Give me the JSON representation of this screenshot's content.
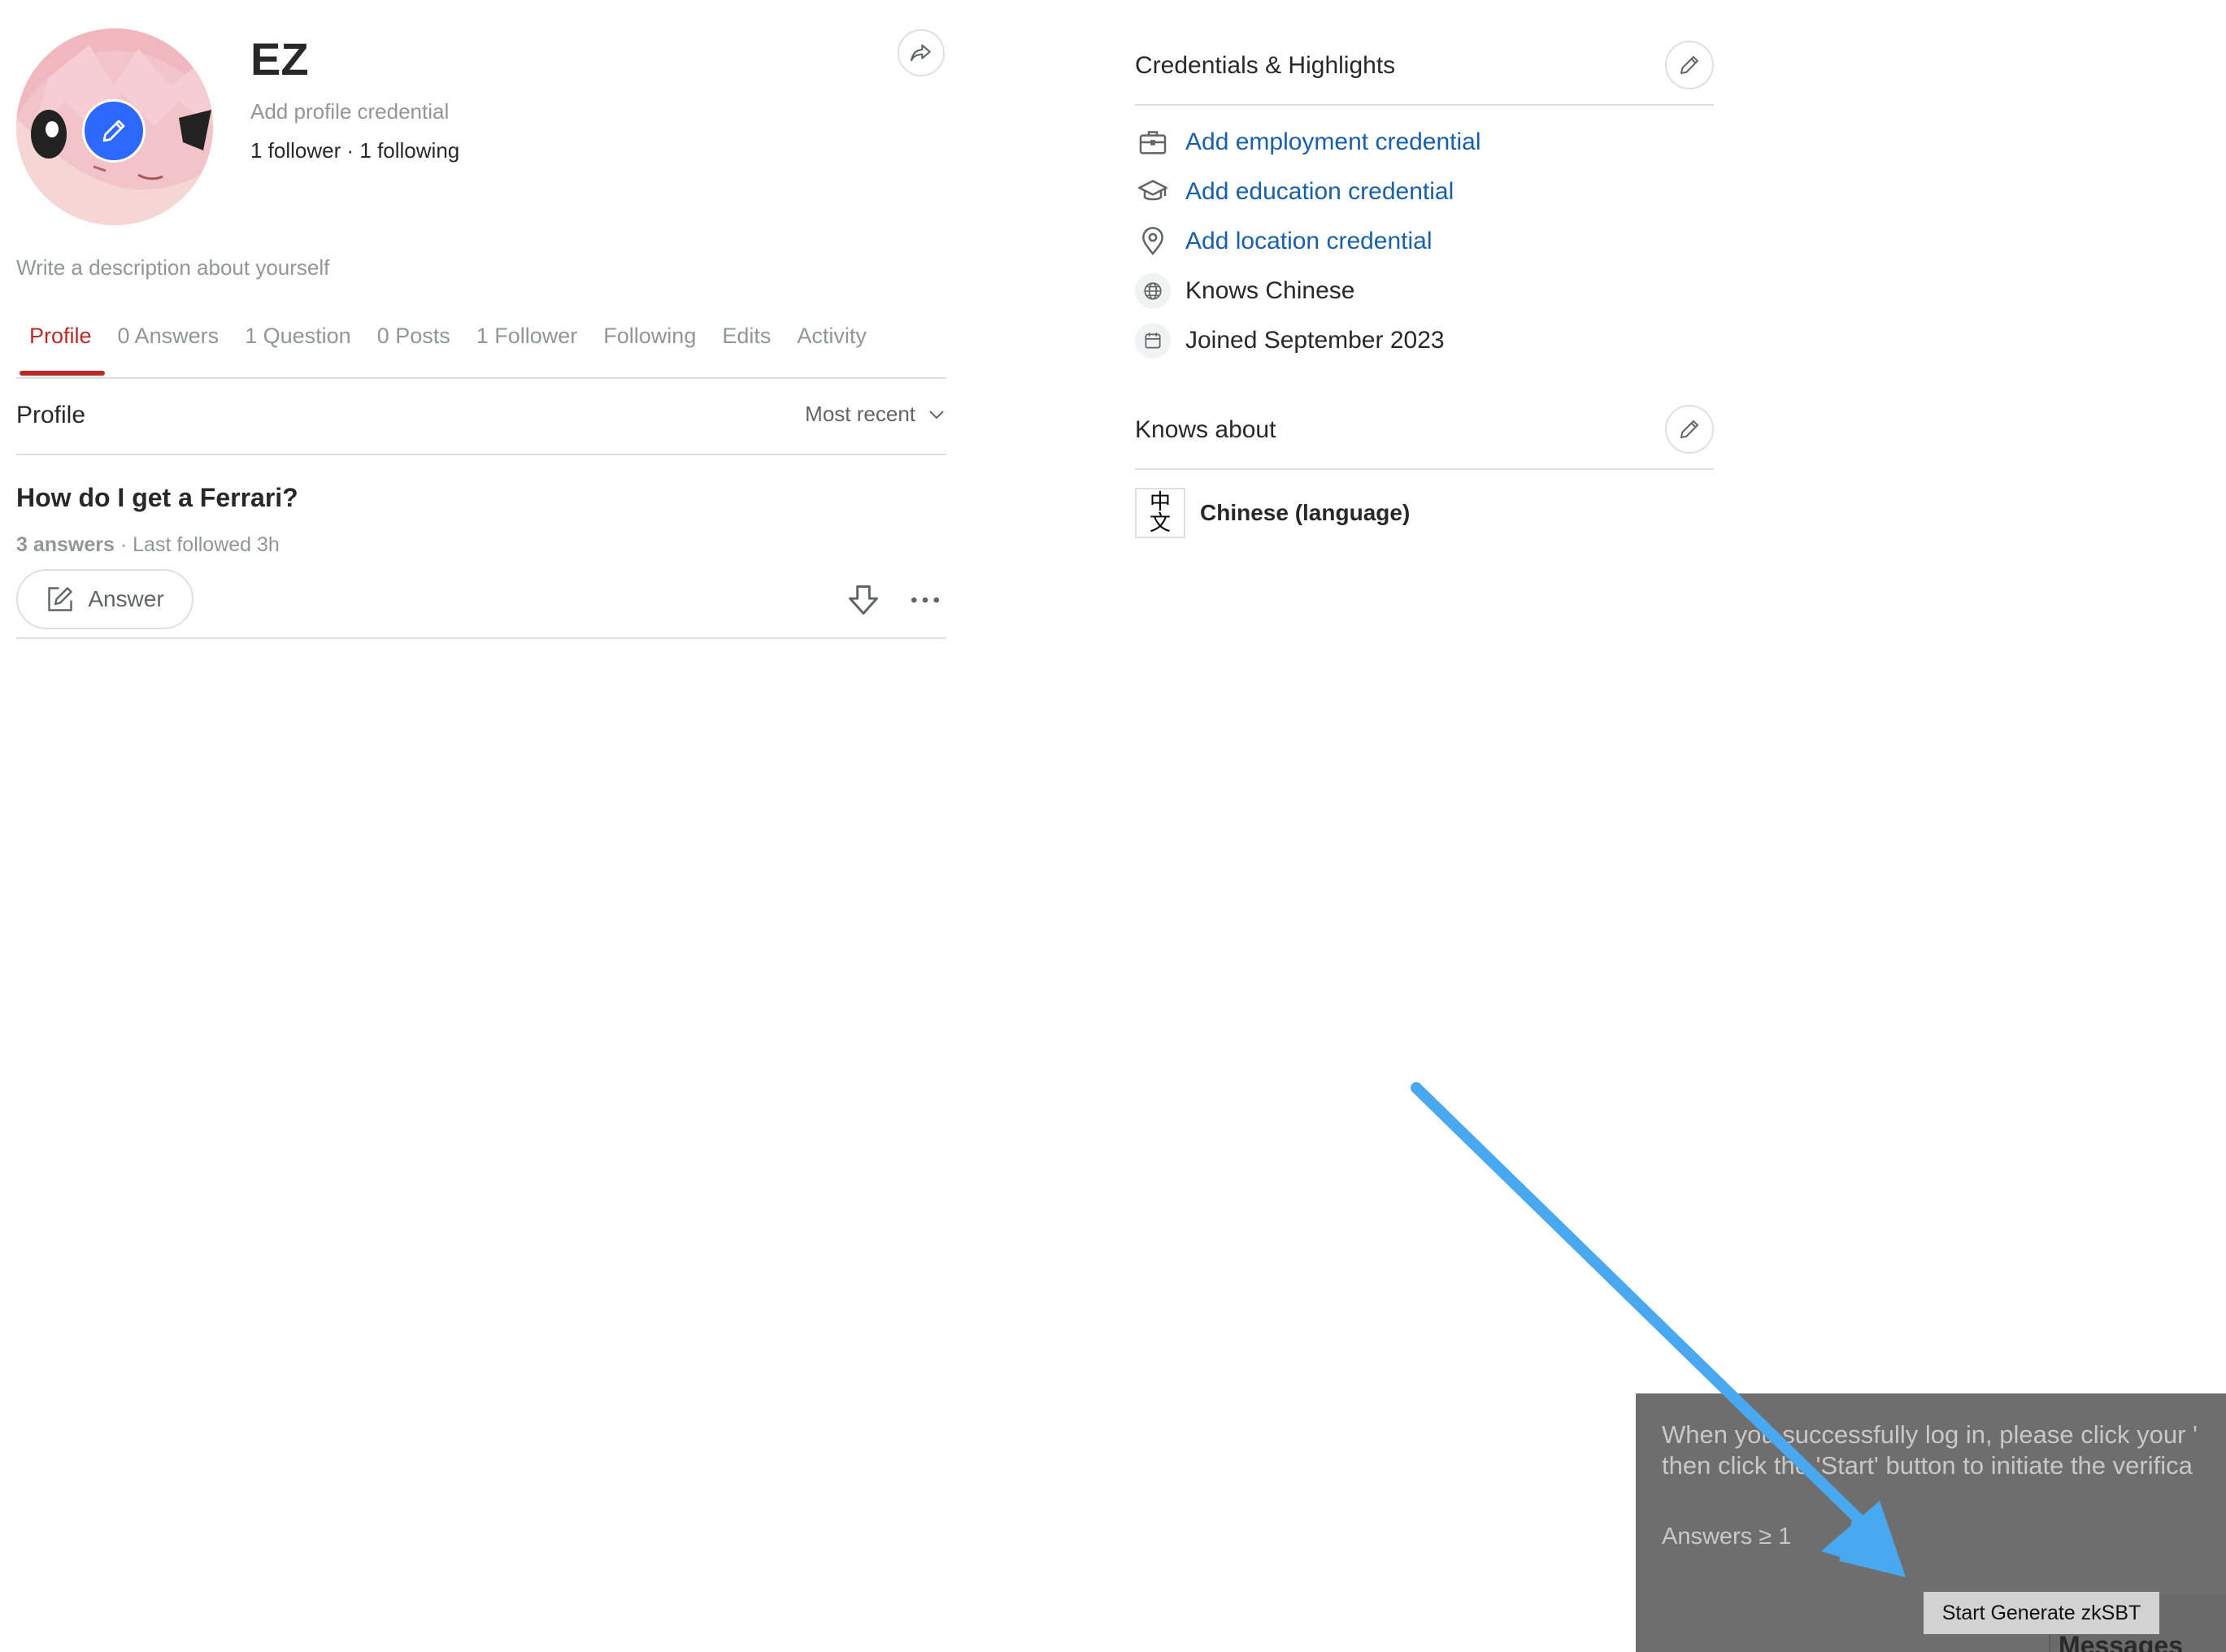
{
  "profile": {
    "name": "EZ",
    "credential_prompt": "Add profile credential",
    "followers": "1 follower",
    "separator": " · ",
    "following": "1 following",
    "description_prompt": "Write a description about yourself"
  },
  "tabs": [
    {
      "label": "Profile",
      "active": true
    },
    {
      "label": "0 Answers"
    },
    {
      "label": "1 Question"
    },
    {
      "label": "0 Posts"
    },
    {
      "label": "1 Follower"
    },
    {
      "label": "Following"
    },
    {
      "label": "Edits"
    },
    {
      "label": "Activity"
    }
  ],
  "feed": {
    "section_title": "Profile",
    "sort_label": "Most recent",
    "items": [
      {
        "title": "How do I get a Ferrari?",
        "answers": "3 answers",
        "meta": " · Last followed 3h",
        "answer_button": "Answer"
      }
    ]
  },
  "credentials": {
    "title": "Credentials & Highlights",
    "items": [
      {
        "icon": "briefcase-icon",
        "label": "Add employment credential",
        "link": true
      },
      {
        "icon": "graduation-cap-icon",
        "label": "Add education credential",
        "link": true
      },
      {
        "icon": "location-pin-icon",
        "label": "Add location credential",
        "link": true
      },
      {
        "icon": "globe-icon",
        "label": "Knows Chinese",
        "link": false
      },
      {
        "icon": "calendar-icon",
        "label": "Joined September 2023",
        "link": false
      }
    ]
  },
  "knows_about": {
    "title": "Knows about",
    "topics": [
      {
        "name": "Chinese (language)",
        "glyph_top": "中",
        "glyph_bottom": "文"
      }
    ]
  },
  "overlay": {
    "line1": "When you successfully log in, please click your '",
    "line2": "then click the 'Start' button to initiate the verifica",
    "requirement": "Answers ≥ 1",
    "button_label": "Start Generate zkSBT",
    "messages_label": "Messages"
  },
  "colors": {
    "accent_red": "#b92b27",
    "link_blue": "#195faa",
    "avatar_edit_blue": "#2e69ff",
    "annotation_arrow": "#4aa8f0"
  }
}
